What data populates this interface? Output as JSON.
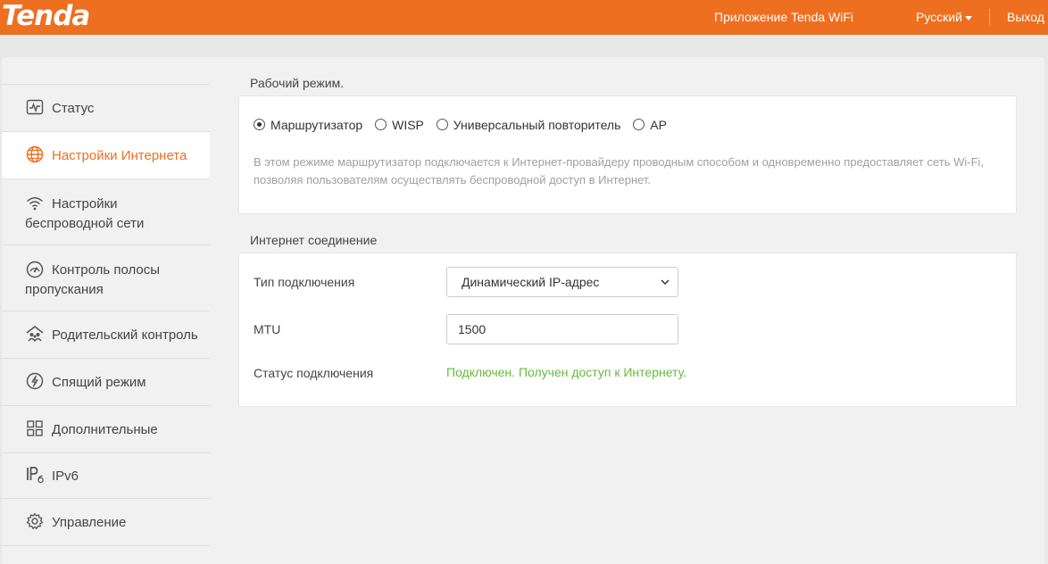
{
  "header": {
    "logo": "Tenda",
    "app_link": "Приложение Tenda WiFi",
    "language": "Русский",
    "logout": "Выход"
  },
  "sidebar": {
    "items": [
      {
        "label": "Статус",
        "icon": "status-icon"
      },
      {
        "label": "Настройки Интернета",
        "icon": "globe-icon",
        "active": true
      },
      {
        "label_line1": "Настройки",
        "label_line2": "беспроводной сети",
        "icon": "wifi-icon"
      },
      {
        "label_line1": "Контроль полосы",
        "label_line2": "пропускания",
        "icon": "gauge-icon"
      },
      {
        "label": "Родительский контроль",
        "icon": "parental-icon"
      },
      {
        "label": "Спящий режим",
        "icon": "sleep-icon"
      },
      {
        "label": "Дополнительные",
        "icon": "grid-icon"
      },
      {
        "label": "IPv6",
        "icon": "ipv6-icon"
      },
      {
        "label": "Управление",
        "icon": "gear-icon"
      }
    ]
  },
  "work_mode": {
    "title": "Рабочий режим.",
    "options": [
      {
        "label": "Маршрутизатор",
        "checked": true
      },
      {
        "label": "WISP",
        "checked": false
      },
      {
        "label": "Универсальный повторитель",
        "checked": false
      },
      {
        "label": "AP",
        "checked": false
      }
    ],
    "description": "В этом режиме маршрутизатор подключается к Интернет-провайдеру проводным способом и одновременно предоставляет сеть Wi-Fi, позволяя пользователям осуществлять беспроводной доступ в Интернет."
  },
  "internet": {
    "title": "Интернет соединение",
    "connection_type_label": "Тип подключения",
    "connection_type_value": "Динамический IP-адрес",
    "mtu_label": "MTU",
    "mtu_value": "1500",
    "status_label": "Статус подключения",
    "status_value": "Подключен. Получен доступ к Интернету."
  },
  "colors": {
    "brand": "#ee6f20",
    "status_ok": "#66bb3a"
  }
}
